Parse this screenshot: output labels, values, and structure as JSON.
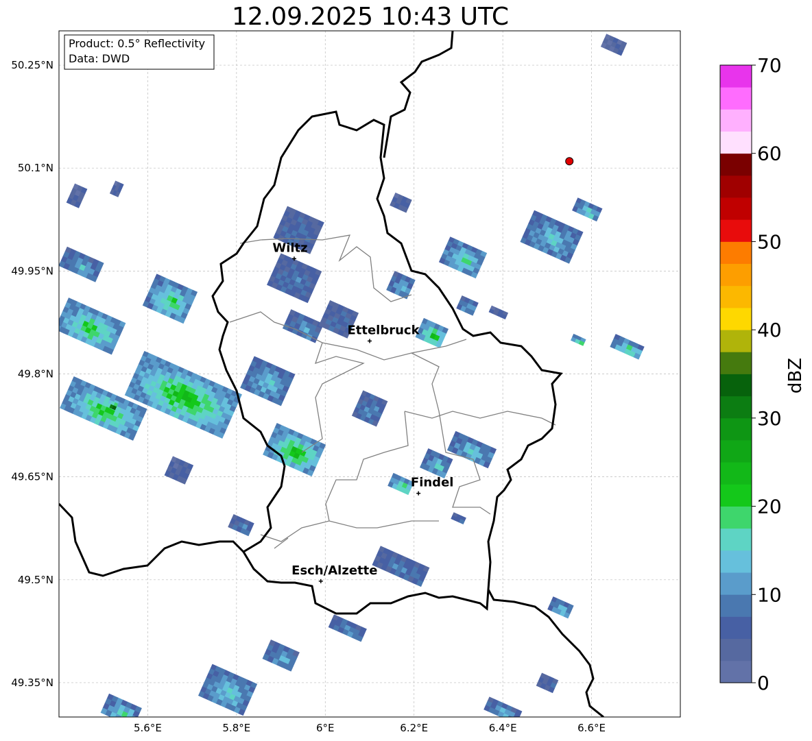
{
  "title": "12.09.2025 10:43 UTC",
  "info_box": {
    "product": "Product: 0.5° Reflectivity",
    "data": "Data: DWD"
  },
  "map": {
    "lon_range": [
      5.4,
      6.8
    ],
    "lat_range": [
      49.3,
      50.3
    ],
    "gridlines": true,
    "lon_ticks": [
      {
        "value": 5.6,
        "label": "5.6°E"
      },
      {
        "value": 5.8,
        "label": "5.8°E"
      },
      {
        "value": 6.0,
        "label": "6°E"
      },
      {
        "value": 6.2,
        "label": "6.2°E"
      },
      {
        "value": 6.4,
        "label": "6.4°E"
      },
      {
        "value": 6.6,
        "label": "6.6°E"
      }
    ],
    "lat_ticks": [
      {
        "value": 50.25,
        "label": "50.25°N"
      },
      {
        "value": 50.1,
        "label": "50.1°N"
      },
      {
        "value": 49.95,
        "label": "49.95°N"
      },
      {
        "value": 49.8,
        "label": "49.8°N"
      },
      {
        "value": 49.65,
        "label": "49.65°N"
      },
      {
        "value": 49.5,
        "label": "49.5°N"
      },
      {
        "value": 49.35,
        "label": "49.35°N"
      }
    ],
    "cities": [
      {
        "name": "Wiltz",
        "lon": 5.93,
        "lat": 49.968
      },
      {
        "name": "Ettelbruck",
        "lon": 6.1,
        "lat": 49.848
      },
      {
        "name": "Findel",
        "lon": 6.21,
        "lat": 49.626
      },
      {
        "name": "Esch/Alzette",
        "lon": 5.99,
        "lat": 49.498
      }
    ],
    "radar_marker": {
      "lon": 6.55,
      "lat": 50.11,
      "color": "#e00000"
    },
    "cells": [
      {
        "lon": 5.44,
        "lat": 50.06,
        "w": 0.03,
        "h": 0.03,
        "dbz": 5
      },
      {
        "lon": 5.53,
        "lat": 50.07,
        "w": 0.02,
        "h": 0.02,
        "dbz": 6
      },
      {
        "lon": 5.45,
        "lat": 49.96,
        "w": 0.09,
        "h": 0.03,
        "dbz": 14
      },
      {
        "lon": 5.47,
        "lat": 49.87,
        "w": 0.14,
        "h": 0.05,
        "dbz": 22
      },
      {
        "lon": 5.65,
        "lat": 49.91,
        "w": 0.1,
        "h": 0.05,
        "dbz": 20
      },
      {
        "lon": 5.68,
        "lat": 49.77,
        "w": 0.24,
        "h": 0.07,
        "dbz": 24
      },
      {
        "lon": 5.5,
        "lat": 49.75,
        "w": 0.18,
        "h": 0.05,
        "dbz": 22
      },
      {
        "lon": 5.52,
        "lat": 49.755,
        "w": 0.02,
        "h": 0.01,
        "dbz": 41
      },
      {
        "lon": 5.67,
        "lat": 49.66,
        "w": 0.05,
        "h": 0.03,
        "dbz": 6
      },
      {
        "lon": 5.94,
        "lat": 50.01,
        "w": 0.09,
        "h": 0.05,
        "dbz": 8
      },
      {
        "lon": 5.93,
        "lat": 49.94,
        "w": 0.1,
        "h": 0.05,
        "dbz": 9
      },
      {
        "lon": 5.95,
        "lat": 49.87,
        "w": 0.08,
        "h": 0.03,
        "dbz": 12
      },
      {
        "lon": 6.03,
        "lat": 49.88,
        "w": 0.07,
        "h": 0.04,
        "dbz": 8
      },
      {
        "lon": 5.87,
        "lat": 49.79,
        "w": 0.1,
        "h": 0.05,
        "dbz": 15
      },
      {
        "lon": 5.93,
        "lat": 49.69,
        "w": 0.12,
        "h": 0.05,
        "dbz": 24
      },
      {
        "lon": 6.1,
        "lat": 49.75,
        "w": 0.06,
        "h": 0.04,
        "dbz": 11
      },
      {
        "lon": 6.17,
        "lat": 50.05,
        "w": 0.04,
        "h": 0.02,
        "dbz": 6
      },
      {
        "lon": 6.17,
        "lat": 49.93,
        "w": 0.05,
        "h": 0.03,
        "dbz": 14
      },
      {
        "lon": 6.24,
        "lat": 49.86,
        "w": 0.06,
        "h": 0.03,
        "dbz": 24
      },
      {
        "lon": 6.31,
        "lat": 49.97,
        "w": 0.09,
        "h": 0.04,
        "dbz": 18
      },
      {
        "lon": 6.32,
        "lat": 49.9,
        "w": 0.04,
        "h": 0.02,
        "dbz": 14
      },
      {
        "lon": 6.39,
        "lat": 49.89,
        "w": 0.04,
        "h": 0.01,
        "dbz": 6
      },
      {
        "lon": 6.51,
        "lat": 50.0,
        "w": 0.12,
        "h": 0.05,
        "dbz": 15
      },
      {
        "lon": 6.59,
        "lat": 50.04,
        "w": 0.06,
        "h": 0.02,
        "dbz": 18
      },
      {
        "lon": 6.57,
        "lat": 49.85,
        "w": 0.03,
        "h": 0.01,
        "dbz": 22
      },
      {
        "lon": 6.68,
        "lat": 49.84,
        "w": 0.07,
        "h": 0.02,
        "dbz": 20
      },
      {
        "lon": 6.65,
        "lat": 50.28,
        "w": 0.05,
        "h": 0.02,
        "dbz": 4
      },
      {
        "lon": 6.25,
        "lat": 49.67,
        "w": 0.06,
        "h": 0.03,
        "dbz": 16
      },
      {
        "lon": 6.33,
        "lat": 49.69,
        "w": 0.1,
        "h": 0.03,
        "dbz": 16
      },
      {
        "lon": 6.17,
        "lat": 49.64,
        "w": 0.05,
        "h": 0.02,
        "dbz": 22
      },
      {
        "lon": 6.3,
        "lat": 49.59,
        "w": 0.03,
        "h": 0.01,
        "dbz": 10
      },
      {
        "lon": 6.17,
        "lat": 49.52,
        "w": 0.12,
        "h": 0.03,
        "dbz": 10
      },
      {
        "lon": 5.81,
        "lat": 49.58,
        "w": 0.05,
        "h": 0.02,
        "dbz": 10
      },
      {
        "lon": 6.05,
        "lat": 49.43,
        "w": 0.08,
        "h": 0.02,
        "dbz": 12
      },
      {
        "lon": 5.9,
        "lat": 49.39,
        "w": 0.07,
        "h": 0.03,
        "dbz": 13
      },
      {
        "lon": 5.78,
        "lat": 49.34,
        "w": 0.11,
        "h": 0.05,
        "dbz": 16
      },
      {
        "lon": 5.54,
        "lat": 49.31,
        "w": 0.08,
        "h": 0.03,
        "dbz": 18
      },
      {
        "lon": 6.4,
        "lat": 49.31,
        "w": 0.08,
        "h": 0.02,
        "dbz": 14
      },
      {
        "lon": 6.53,
        "lat": 49.46,
        "w": 0.05,
        "h": 0.02,
        "dbz": 16
      },
      {
        "lon": 6.5,
        "lat": 49.35,
        "w": 0.04,
        "h": 0.02,
        "dbz": 8
      }
    ]
  },
  "colorbar": {
    "label": "dBZ",
    "min": 0,
    "max": 70,
    "step": 2.5,
    "ticks": [
      0,
      10,
      20,
      30,
      40,
      50,
      60,
      70
    ],
    "colors": [
      "#6272a8",
      "#5669a0",
      "#4760a4",
      "#4a78b0",
      "#5a9ccb",
      "#66c0dc",
      "#5ed4c4",
      "#3ed66c",
      "#14c81a",
      "#12b818",
      "#10a716",
      "#0e9614",
      "#0c7d12",
      "#07620c",
      "#457a0e",
      "#b0b40a",
      "#fed800",
      "#fcb800",
      "#fd9e00",
      "#fd7c00",
      "#e80c0c",
      "#c00000",
      "#a00000",
      "#7a0000",
      "#ffe0fe",
      "#ffb0fe",
      "#ff6cfe",
      "#e834ec"
    ]
  }
}
